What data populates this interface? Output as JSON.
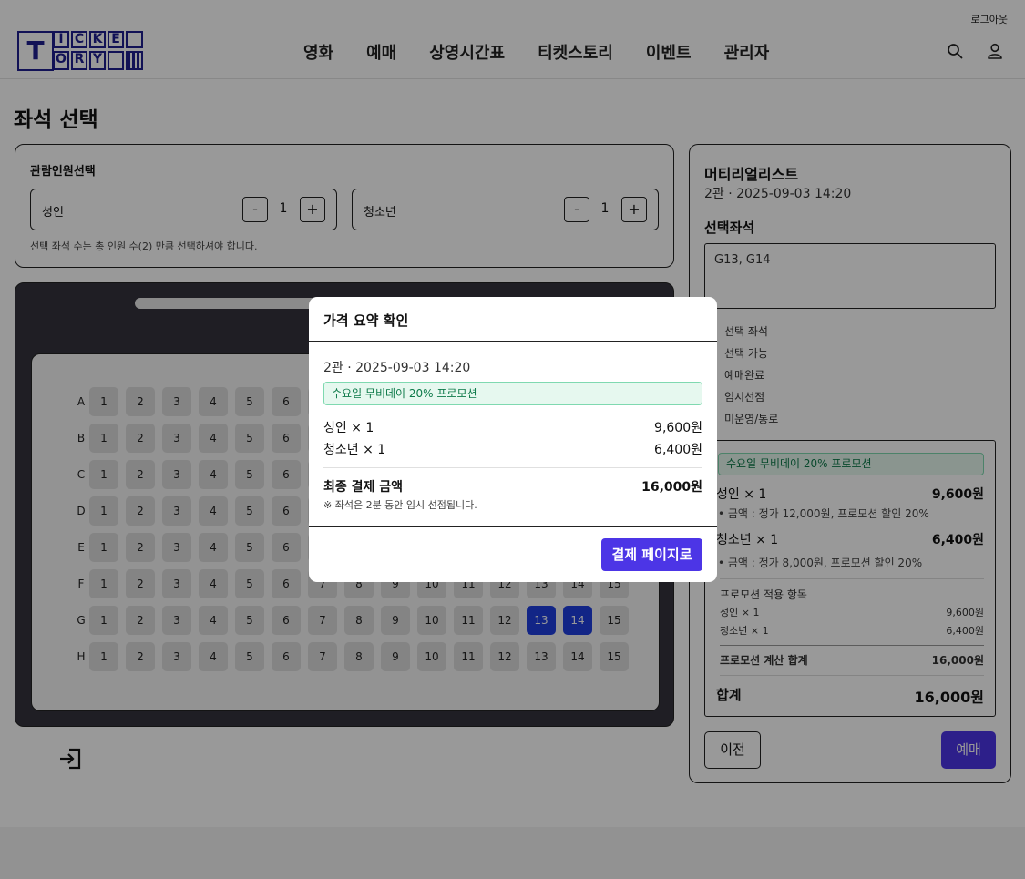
{
  "header": {
    "logout": "로그아웃",
    "logo_letters": [
      "T",
      "I",
      "C",
      "K",
      "E",
      "O",
      "R",
      "Y"
    ],
    "nav": [
      "영화",
      "예매",
      "상영시간표",
      "티켓스토리",
      "이벤트",
      "관리자"
    ],
    "icons": [
      "search-icon",
      "user-icon"
    ]
  },
  "page": {
    "title": "좌석 선택"
  },
  "people": {
    "title": "관람인원선택",
    "adult_label": "성인",
    "adult_count": "1",
    "youth_label": "청소년",
    "youth_count": "1",
    "minus": "-",
    "plus": "+",
    "hint": "선택 좌석 수는 총 인원 수(2) 만큼 선택하셔야 합니다."
  },
  "seats": {
    "rows": [
      "A",
      "B",
      "C",
      "D",
      "E",
      "F",
      "G",
      "H"
    ],
    "columns": [
      "1",
      "2",
      "3",
      "4",
      "5",
      "6",
      "7",
      "8",
      "9",
      "10",
      "11",
      "12",
      "13",
      "14",
      "15"
    ],
    "selected": [
      "G13",
      "G14"
    ],
    "colors": {
      "seat": "#dcdcdc",
      "selected": "#1f3ee0",
      "theater_bg": "#34333d"
    }
  },
  "summary": {
    "movie": "머티리얼리스트",
    "showtime": "2관 · 2025-09-03 14:20",
    "seat_title": "선택좌석",
    "seat_value": "G13, G14",
    "legend": [
      {
        "label": "선택 좌석",
        "color": "#1f3ee0"
      },
      {
        "label": "선택 가능",
        "color": "#dcdcdc"
      },
      {
        "label": "예매완료",
        "color": "#8a8a8a"
      },
      {
        "label": "임시선점",
        "color": "#f2a73b"
      },
      {
        "label": "미운영/통로",
        "color": "#ffffff"
      }
    ],
    "promo": "수요일 무비데이 20% 프로모션",
    "adult_line": "성인 × 1",
    "adult_price": "9,600원",
    "adult_detail": "• 금액 : 정가 12,000원, 프로모션 할인 20%",
    "youth_line": "청소년 × 1",
    "youth_price": "6,400원",
    "youth_detail": "• 금액 : 정가 8,000원, 프로모션 할인 20%",
    "applied_title": "프로모션 적용 항목",
    "applied_adult": "성인 × 1",
    "applied_adult_price": "9,600원",
    "applied_youth": "청소년 × 1",
    "applied_youth_price": "6,400원",
    "promo_total_label": "프로모션 계산 합계",
    "promo_total": "16,000원",
    "total_label": "합계",
    "total": "16,000원",
    "prev_button": "이전",
    "book_button": "예매"
  },
  "modal": {
    "title": "가격 요약 확인",
    "showtime": "2관 · 2025-09-03 14:20",
    "promo": "수요일 무비데이 20% 프로모션",
    "adult_line": "성인 × 1",
    "adult_price": "9,600원",
    "youth_line": "청소년 × 1",
    "youth_price": "6,400원",
    "final_label": "최종 결제 금액",
    "final_price": "16,000원",
    "note": "※ 좌석은 2분 동안 임시 선점됩니다.",
    "pay_button": "결제 페이지로"
  },
  "colors": {
    "accent": "#4c35e6",
    "promo_bg": "#e6f8ef",
    "promo_text": "#0e7a4a",
    "logo": "#1f1f8f"
  }
}
